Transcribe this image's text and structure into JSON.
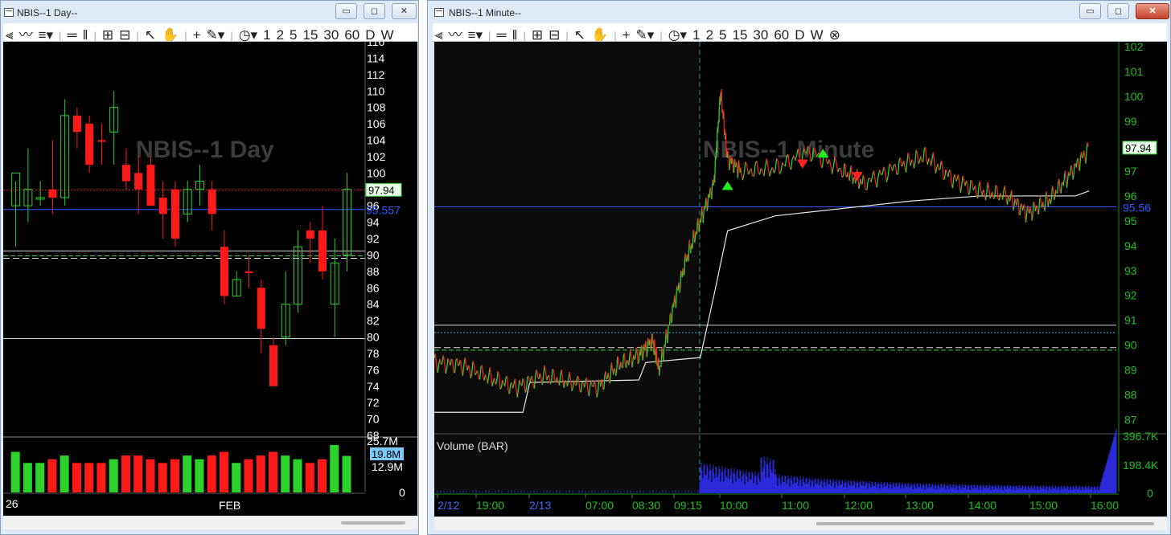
{
  "left_window": {
    "title": "NBIS--1 Day--",
    "watermark": "NBIS--1 Day",
    "toolbar_items": [
      "⫷",
      "〰",
      "≡▾",
      "|",
      "═",
      "‖",
      "|",
      "⊞",
      "⊟",
      "|",
      "↖",
      "✋",
      "|",
      "+",
      "✎▾",
      "|",
      "◷▾",
      "1",
      "2",
      "5",
      "15",
      "30",
      "60",
      "D",
      "W"
    ],
    "y_ticks": [
      "116",
      "114",
      "112",
      "110",
      "108",
      "106",
      "104",
      "102",
      "100",
      "98",
      "96",
      "94",
      "92",
      "90",
      "88",
      "86",
      "84",
      "82",
      "80",
      "78",
      "76",
      "74",
      "72",
      "70",
      "68"
    ],
    "price_tag": "97.94",
    "line_label": "95.557",
    "volume_ticks": [
      "25.7M",
      "12.9M",
      "0"
    ],
    "volume_tag": "19.8M",
    "x_labels": [
      "26",
      "FEB"
    ],
    "minimize": "▭",
    "maximize": "◻",
    "close": "✕"
  },
  "right_window": {
    "title": "NBIS--1 Minute--",
    "watermark": "NBIS--1 Minute",
    "toolbar_items": [
      "⫷",
      "〰",
      "≡▾",
      "|",
      "═",
      "‖",
      "|",
      "⊞",
      "⊟",
      "|",
      "↖",
      "✋",
      "|",
      "+",
      "✎▾",
      "|",
      "◷▾",
      "1",
      "2",
      "5",
      "15",
      "30",
      "60",
      "D",
      "W",
      "⊗"
    ],
    "y_ticks": [
      "102",
      "101",
      "100",
      "99",
      "98",
      "97",
      "96",
      "95",
      "94",
      "93",
      "92",
      "91",
      "90",
      "89",
      "88",
      "87"
    ],
    "price_tag": "97.94",
    "line_label": "95.56",
    "volume_title": "Volume (BAR)",
    "volume_ticks": [
      "396.7K",
      "198.4K",
      "0"
    ],
    "x_labels": [
      "2/12",
      "19:00",
      "2/13",
      "07:00",
      "08:30",
      "09:15",
      "10:00",
      "11:00",
      "12:00",
      "13:00",
      "14:00",
      "15:00",
      "16:00"
    ],
    "minimize": "▭",
    "maximize": "◻",
    "close": "✕"
  },
  "colors": {
    "up": "#2dd22d",
    "down": "#ff1a1a",
    "blue_line": "#2b5cff",
    "volume_blue": "#2a2ad8",
    "axis_green": "#1fbf1f"
  },
  "chart_data": [
    {
      "type": "candlestick",
      "title": "NBIS--1 Day",
      "ylim": [
        68,
        116
      ],
      "candles": [
        {
          "o": 96,
          "h": 99,
          "l": 91,
          "c": 100,
          "d": "up"
        },
        {
          "o": 96,
          "h": 103,
          "l": 94,
          "c": 98,
          "d": "up"
        },
        {
          "o": 97,
          "h": 99,
          "l": 96,
          "c": 97,
          "d": "up"
        },
        {
          "o": 98,
          "h": 104,
          "l": 95,
          "c": 97,
          "d": "down"
        },
        {
          "o": 97,
          "h": 109,
          "l": 96,
          "c": 107,
          "d": "up"
        },
        {
          "o": 107,
          "h": 108,
          "l": 103,
          "c": 105,
          "d": "down"
        },
        {
          "o": 106,
          "h": 107,
          "l": 100,
          "c": 101,
          "d": "down"
        },
        {
          "o": 104,
          "h": 106,
          "l": 101,
          "c": 104,
          "d": "down"
        },
        {
          "o": 105,
          "h": 110,
          "l": 101,
          "c": 108,
          "d": "up"
        },
        {
          "o": 101,
          "h": 103,
          "l": 98,
          "c": 99,
          "d": "down"
        },
        {
          "o": 100,
          "h": 102,
          "l": 95,
          "c": 98,
          "d": "down"
        },
        {
          "o": 101,
          "h": 102,
          "l": 96,
          "c": 96,
          "d": "down"
        },
        {
          "o": 97,
          "h": 99,
          "l": 92,
          "c": 95,
          "d": "down"
        },
        {
          "o": 98,
          "h": 99,
          "l": 91,
          "c": 92,
          "d": "down"
        },
        {
          "o": 95,
          "h": 99,
          "l": 94,
          "c": 98,
          "d": "up"
        },
        {
          "o": 98,
          "h": 101,
          "l": 96,
          "c": 99,
          "d": "up"
        },
        {
          "o": 98,
          "h": 99,
          "l": 93,
          "c": 95,
          "d": "down"
        },
        {
          "o": 91,
          "h": 93,
          "l": 84,
          "c": 85,
          "d": "down"
        },
        {
          "o": 85,
          "h": 88,
          "l": 85,
          "c": 87,
          "d": "up"
        },
        {
          "o": 88,
          "h": 90,
          "l": 86,
          "c": 88,
          "d": "down"
        },
        {
          "o": 86,
          "h": 87,
          "l": 78,
          "c": 81,
          "d": "down"
        },
        {
          "o": 79,
          "h": 80,
          "l": 74,
          "c": 74,
          "d": "down"
        },
        {
          "o": 80,
          "h": 88,
          "l": 79,
          "c": 84,
          "d": "up"
        },
        {
          "o": 84,
          "h": 93,
          "l": 83,
          "c": 91,
          "d": "up"
        },
        {
          "o": 93,
          "h": 94,
          "l": 89,
          "c": 92,
          "d": "down"
        },
        {
          "o": 93,
          "h": 96,
          "l": 87,
          "c": 88,
          "d": "down"
        },
        {
          "o": 84,
          "h": 92,
          "l": 80,
          "c": 89,
          "d": "up"
        },
        {
          "o": 90,
          "h": 100,
          "l": 88,
          "c": 98,
          "d": "up"
        }
      ],
      "volume_ylim": [
        0,
        25.7
      ],
      "volumes": [
        22,
        16,
        16,
        18,
        20,
        16,
        16,
        16,
        18,
        20,
        20,
        18,
        16,
        18,
        20,
        18,
        20,
        22,
        16,
        18,
        20,
        22,
        20,
        18,
        16,
        18,
        25.7,
        19.8
      ],
      "hlines": [
        {
          "y": 97.94,
          "style": "red-dotted"
        },
        {
          "y": 95.557,
          "style": "blue"
        },
        {
          "y": 90.5,
          "style": "white"
        },
        {
          "y": 89.9,
          "style": "green-dashed"
        },
        {
          "y": 89.6,
          "style": "white-dashed"
        },
        {
          "y": 79.8,
          "style": "white"
        }
      ]
    },
    {
      "type": "line",
      "title": "NBIS--1 Minute",
      "ylim": [
        86.5,
        102.2
      ],
      "price_path": [
        [
          0,
          89.3
        ],
        [
          0.04,
          89.2
        ],
        [
          0.08,
          88.7
        ],
        [
          0.12,
          88.3
        ],
        [
          0.16,
          88.8
        ],
        [
          0.2,
          88.5
        ],
        [
          0.24,
          88.3
        ],
        [
          0.27,
          89.2
        ],
        [
          0.3,
          89.6
        ],
        [
          0.32,
          90.2
        ],
        [
          0.33,
          89.0
        ],
        [
          0.35,
          91.5
        ],
        [
          0.37,
          93.5
        ],
        [
          0.39,
          95.0
        ],
        [
          0.41,
          96.5
        ],
        [
          0.42,
          100.2
        ],
        [
          0.43,
          97.5
        ],
        [
          0.45,
          97.0
        ],
        [
          0.5,
          97.1
        ],
        [
          0.55,
          97.8
        ],
        [
          0.6,
          97.0
        ],
        [
          0.63,
          96.5
        ],
        [
          0.68,
          97.2
        ],
        [
          0.72,
          97.6
        ],
        [
          0.76,
          96.7
        ],
        [
          0.8,
          96.2
        ],
        [
          0.84,
          96.0
        ],
        [
          0.87,
          95.3
        ],
        [
          0.9,
          95.8
        ],
        [
          0.93,
          96.8
        ],
        [
          0.96,
          97.9
        ]
      ],
      "vwap_path": [
        [
          0,
          87.3
        ],
        [
          0.13,
          87.3
        ],
        [
          0.14,
          88.5
        ],
        [
          0.3,
          88.6
        ],
        [
          0.31,
          89.3
        ],
        [
          0.39,
          89.5
        ],
        [
          0.41,
          92
        ],
        [
          0.43,
          94.6
        ],
        [
          0.5,
          95.2
        ],
        [
          0.6,
          95.5
        ],
        [
          0.7,
          95.8
        ],
        [
          0.8,
          96.0
        ],
        [
          0.94,
          96.0
        ],
        [
          0.96,
          96.2
        ]
      ],
      "volume_ylim": [
        0,
        396.7
      ],
      "x_labels": [
        "2/12",
        "19:00",
        "2/13",
        "07:00",
        "08:30",
        "09:15",
        "10:00",
        "11:00",
        "12:00",
        "13:00",
        "14:00",
        "15:00",
        "16:00"
      ],
      "hlines": [
        {
          "y": 95.56,
          "style": "blue"
        },
        {
          "y": 90.8,
          "style": "white"
        },
        {
          "y": 90.5,
          "style": "cyan-dotted"
        },
        {
          "y": 89.9,
          "style": "white-dashed"
        },
        {
          "y": 89.8,
          "style": "green-dashed"
        }
      ],
      "markers": [
        {
          "x": 0.43,
          "y": 96.4,
          "dir": "up"
        },
        {
          "x": 0.54,
          "y": 97.3,
          "dir": "down"
        },
        {
          "x": 0.57,
          "y": 97.7,
          "dir": "up"
        },
        {
          "x": 0.62,
          "y": 96.8,
          "dir": "down"
        }
      ]
    }
  ]
}
